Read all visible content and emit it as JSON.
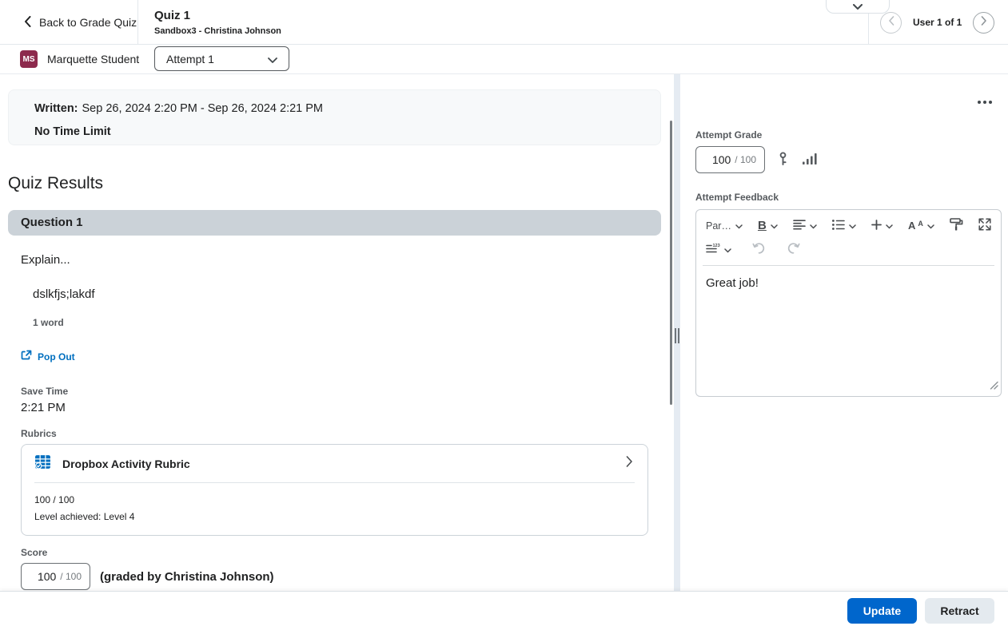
{
  "header": {
    "back_label": "Back to Grade Quiz",
    "title": "Quiz 1",
    "subtitle": "Sandbox3 - Christina Johnson",
    "user_nav_label": "User 1 of 1"
  },
  "attempt_bar": {
    "avatar_initials": "MS",
    "student_name": "Marquette Student",
    "attempt_selected": "Attempt 1"
  },
  "quiz_info": {
    "written_label": "Written:",
    "written_value": "Sep 26, 2024 2:20 PM - Sep 26, 2024 2:21 PM",
    "time_limit": "No Time Limit"
  },
  "results": {
    "heading": "Quiz Results",
    "question_title": "Question 1",
    "question_text": "Explain...",
    "answer_text": "dslkfjs;lakdf",
    "word_count": "1 word",
    "popout_label": "Pop Out",
    "save_time_label": "Save Time",
    "save_time_value": "2:21 PM",
    "rubrics_label": "Rubrics",
    "rubric": {
      "name": "Dropbox Activity Rubric",
      "score": "100 / 100",
      "level": "Level achieved: Level 4"
    },
    "score_label": "Score",
    "score_value": "100",
    "score_out_of": "/ 100",
    "graded_by": "(graded by Christina Johnson)"
  },
  "grading_panel": {
    "attempt_grade_label": "Attempt Grade",
    "grade_value": "100",
    "grade_out_of": "/ 100",
    "attempt_feedback_label": "Attempt Feedback",
    "feedback_text": "Great job!",
    "editor": {
      "format_label": "Par…",
      "bold_label": "B",
      "font_label": "A",
      "font_small_label": "A"
    }
  },
  "footer": {
    "update_label": "Update",
    "retract_label": "Retract"
  },
  "icons": {
    "back": "chevron-left",
    "collapse_header": "chevron-down",
    "prev_user": "chevron-left-circle",
    "next_user": "chevron-right-circle",
    "attempt_dropdown": "chevron-down",
    "pop_out": "external-window-arrow",
    "rubric": "rubric-grid-check",
    "rubric_expand": "chevron-right",
    "grade_scheme": "key",
    "statistics": "bar-chart",
    "overflow_menu": "ellipsis",
    "editor_toolbar": [
      "paragraph-format",
      "bold",
      "alignment",
      "list",
      "insert-plus",
      "font-family",
      "format-painter",
      "fullscreen",
      "line-numbering",
      "undo",
      "redo"
    ],
    "editor_resize": "drag-corner"
  },
  "colors": {
    "primary_action": "#0066cc",
    "link": "#006fbf",
    "avatar_badge": "#8d2a4d",
    "question_header_bg": "#cbd2d8",
    "info_box_bg": "#f7f9fa",
    "splitter_bg": "#e5ebf2"
  }
}
